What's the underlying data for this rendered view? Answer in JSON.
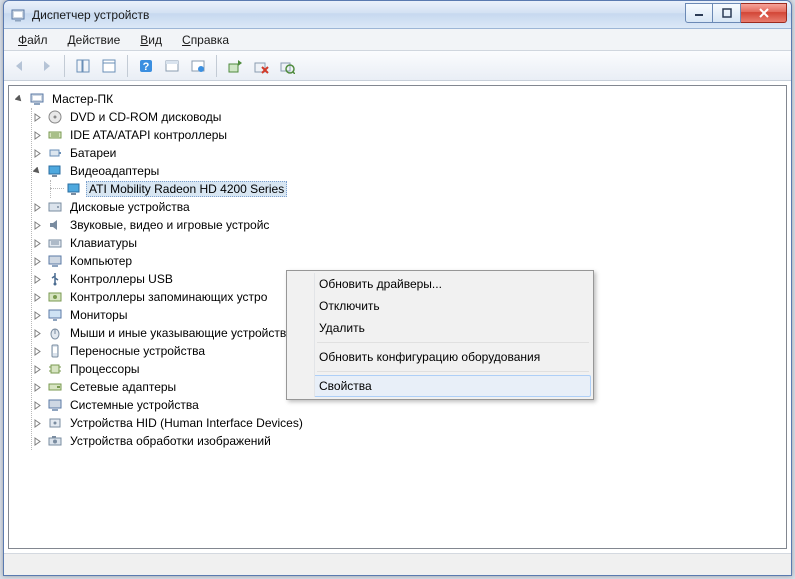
{
  "window": {
    "title": "Диспетчер устройств"
  },
  "menu": {
    "file": {
      "letter": "Ф",
      "rest": "айл"
    },
    "action": {
      "letter": "Д",
      "rest": "ействие"
    },
    "view": {
      "letter": "В",
      "rest": "ид"
    },
    "help": {
      "letter": "С",
      "rest": "правка"
    }
  },
  "tree": {
    "root": "Мастер-ПК",
    "items": [
      "DVD и CD-ROM дисководы",
      "IDE ATA/ATAPI контроллеры",
      "Батареи"
    ],
    "video_adapters": {
      "label": "Видеоадаптеры",
      "child": "ATI Mobility Radeon HD 4200 Series"
    },
    "items2": [
      "Дисковые устройства",
      "Звуковые, видео и игровые устройс",
      "Клавиатуры",
      "Компьютер",
      "Контроллеры USB",
      "Контроллеры запоминающих устро",
      "Мониторы",
      "Мыши и иные указывающие устройства",
      "Переносные устройства",
      "Процессоры",
      "Сетевые адаптеры",
      "Системные устройства",
      "Устройства HID (Human Interface Devices)",
      "Устройства обработки изображений"
    ]
  },
  "context": {
    "update_drivers": "Обновить драйверы...",
    "disable": "Отключить",
    "delete": "Удалить",
    "scan_hw": "Обновить конфигурацию оборудования",
    "properties": "Свойства"
  }
}
